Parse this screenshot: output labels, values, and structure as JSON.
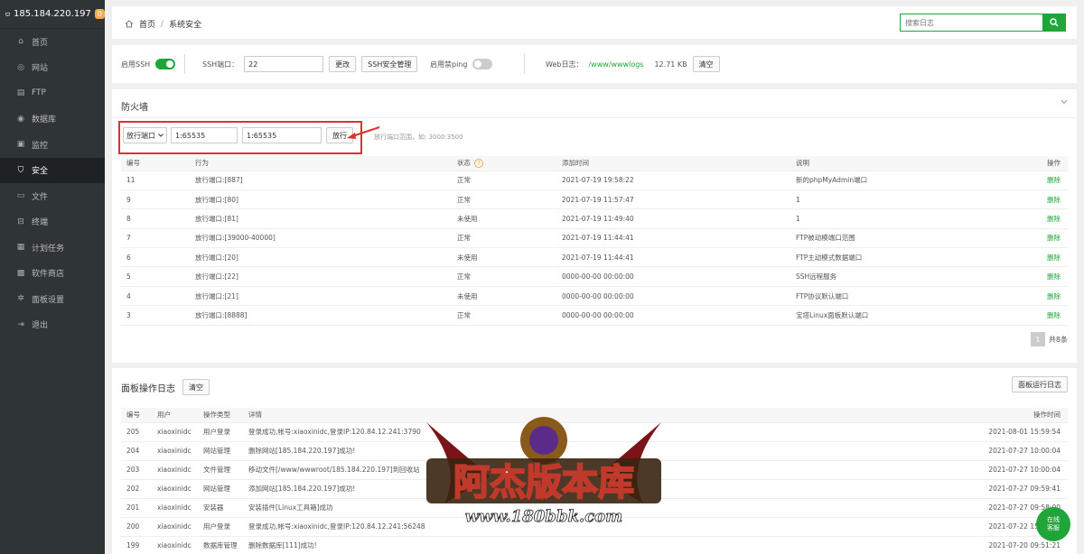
{
  "sidebar": {
    "server_ip": "185.184.220.197",
    "badge": "0",
    "items": [
      {
        "label": "首页",
        "icon": "home-icon"
      },
      {
        "label": "网站",
        "icon": "globe-icon"
      },
      {
        "label": "FTP",
        "icon": "ftp-icon"
      },
      {
        "label": "数据库",
        "icon": "database-icon"
      },
      {
        "label": "监控",
        "icon": "monitor-icon"
      },
      {
        "label": "安全",
        "icon": "shield-icon"
      },
      {
        "label": "文件",
        "icon": "folder-icon"
      },
      {
        "label": "终端",
        "icon": "terminal-icon"
      },
      {
        "label": "计划任务",
        "icon": "calendar-icon"
      },
      {
        "label": "软件商店",
        "icon": "apps-icon"
      },
      {
        "label": "面板设置",
        "icon": "gear-icon"
      },
      {
        "label": "退出",
        "icon": "logout-icon"
      }
    ],
    "active_index": 5
  },
  "breadcrumb": {
    "home": "首页",
    "sep": "/",
    "current": "系统安全"
  },
  "search": {
    "placeholder": "搜索日志"
  },
  "options": {
    "ssh_label": "启用SSH",
    "ssh_on": true,
    "ssh_port_label": "SSH端口：",
    "ssh_port_value": "22",
    "change_btn": "更改",
    "ssh_mgmt_btn": "SSH安全管理",
    "ping_label": "启用禁ping",
    "ping_on": false,
    "weblog_label": "Web日志：",
    "weblog_path": "/www/wwwlogs",
    "weblog_size": "12.71 KB",
    "clear_btn": "清空"
  },
  "firewall": {
    "title": "防火墙",
    "select_value": "放行端口",
    "port_input_1": "1:65535",
    "port_input_2": "1:65535",
    "submit_btn": "放行",
    "hint": "放行端口范围，如: 3000:3500",
    "columns": [
      "编号",
      "行为",
      "状态",
      "添加时间",
      "说明",
      "操作"
    ],
    "rows": [
      {
        "id": "11",
        "action": "放行端口:[887]",
        "status": "正常",
        "time": "2021-07-19 19:58:22",
        "note": "新的phpMyAdmin端口",
        "op": "删除"
      },
      {
        "id": "9",
        "action": "放行端口:[80]",
        "status": "正常",
        "time": "2021-07-19 11:57:47",
        "note": "1",
        "op": "删除"
      },
      {
        "id": "8",
        "action": "放行端口:[81]",
        "status": "未使用",
        "time": "2021-07-19 11:49:40",
        "note": "1",
        "op": "删除"
      },
      {
        "id": "7",
        "action": "放行端口:[39000-40000]",
        "status": "正常",
        "time": "2021-07-19 11:44:41",
        "note": "FTP被动模端口范围",
        "op": "删除"
      },
      {
        "id": "6",
        "action": "放行端口:[20]",
        "status": "未使用",
        "time": "2021-07-19 11:44:41",
        "note": "FTP主动模式数据端口",
        "op": "删除"
      },
      {
        "id": "5",
        "action": "放行端口:[22]",
        "status": "正常",
        "time": "0000-00-00 00:00:00",
        "note": "SSH远程服务",
        "op": "删除"
      },
      {
        "id": "4",
        "action": "放行端口:[21]",
        "status": "未使用",
        "time": "0000-00-00 00:00:00",
        "note": "FTP协议默认端口",
        "op": "删除"
      },
      {
        "id": "3",
        "action": "放行端口:[8888]",
        "status": "正常",
        "time": "0000-00-00 00:00:00",
        "note": "宝塔Linux面板默认端口",
        "op": "删除"
      }
    ],
    "pager_current": "1",
    "pager_total": "共8条"
  },
  "panel_log": {
    "title": "面板操作日志",
    "clear_btn": "清空",
    "run_log_btn": "面板运行日志",
    "columns": [
      "编号",
      "用户",
      "操作类型",
      "详情",
      "操作时间"
    ],
    "rows": [
      {
        "id": "205",
        "user": "xiaoxinidc",
        "type": "用户登录",
        "detail": "登录成功,帐号:xiaoxinidc,登录IP:120.84.12.241:3790",
        "time": "2021-08-01 15:59:54"
      },
      {
        "id": "204",
        "user": "xiaoxinidc",
        "type": "网站管理",
        "detail": "删除网站[185.184.220.197]成功!",
        "time": "2021-07-27 10:00:04"
      },
      {
        "id": "203",
        "user": "xiaoxinidc",
        "type": "文件管理",
        "detail": "移动文件[/www/wwwroot/185.184.220.197]到回收站",
        "time": "2021-07-27 10:00:04"
      },
      {
        "id": "202",
        "user": "xiaoxinidc",
        "type": "网站管理",
        "detail": "添加网站[185.184.220.197]成功!",
        "time": "2021-07-27 09:59:41"
      },
      {
        "id": "201",
        "user": "xiaoxinidc",
        "type": "安装器",
        "detail": "安装插件[Linux工具箱]成功",
        "time": "2021-07-27 09:58:00"
      },
      {
        "id": "200",
        "user": "xiaoxinidc",
        "type": "用户登录",
        "detail": "登录成功,帐号:xiaoxinidc,登录IP:120.84.12.241:56248",
        "time": "2021-07-22 15:51:03"
      },
      {
        "id": "199",
        "user": "xiaoxinidc",
        "type": "数据库管理",
        "detail": "删除数据库[111]成功!",
        "time": "2021-07-20 09:51:21"
      }
    ]
  },
  "help_bubble": {
    "line1": "在线",
    "line2": "客服"
  },
  "watermark": {
    "title": "阿杰版本库",
    "url": "www.180bbk.com"
  },
  "colors": {
    "accent": "#20a53a",
    "sidebar_bg": "#2f3437",
    "highlight_box": "#e03131"
  }
}
